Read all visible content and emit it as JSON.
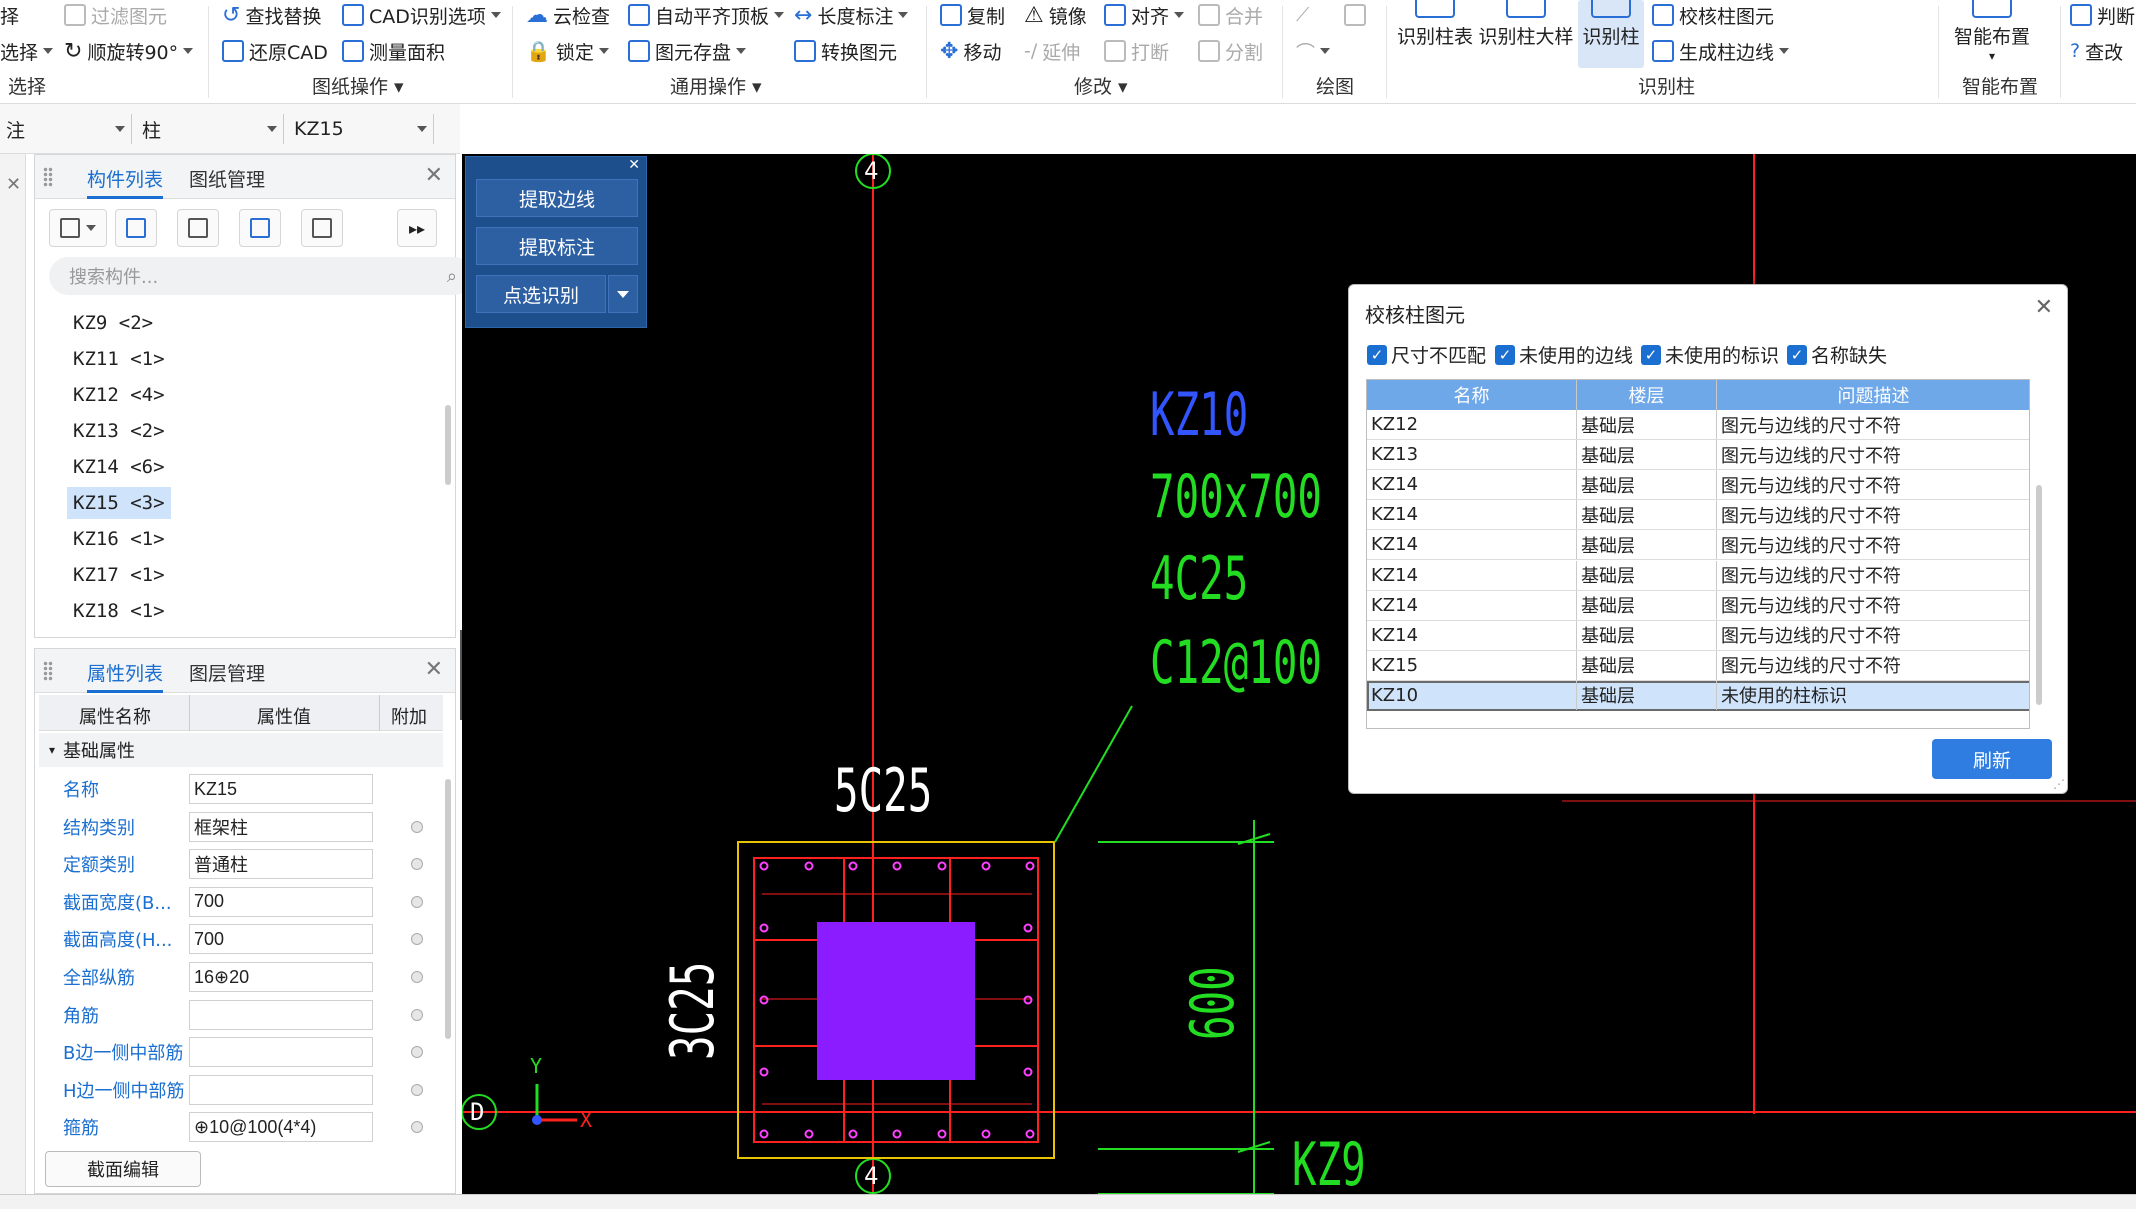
{
  "ribbon": {
    "select_group": {
      "item1": "择",
      "item2": "选择",
      "label": "选择",
      "filter": "过滤图元",
      "rotate": "顺旋转90°"
    },
    "drawing_ops": {
      "find_replace": "查找替换",
      "cad_options": "CAD识别选项",
      "restore_cad": "还原CAD",
      "measure_area": "测量面积",
      "label": "图纸操作"
    },
    "general_ops": {
      "cloud_check": "云检查",
      "auto_level": "自动平齐顶板",
      "length_dim": "长度标注",
      "lock": "锁定",
      "save_elem": "图元存盘",
      "convert_elem": "转换图元",
      "label": "通用操作"
    },
    "modify": {
      "copy": "复制",
      "mirror": "镜像",
      "align": "对齐",
      "merge": "合并",
      "move": "移动",
      "extend": "延伸",
      "break": "打断",
      "split": "分割",
      "label": "修改"
    },
    "draw": {
      "label": "绘图"
    },
    "recognize_column": {
      "recog_table": "识别柱表",
      "recog_detail": "识别柱大样",
      "recog_column": "识别柱",
      "check_elem": "校核柱图元",
      "gen_edge": "生成柱边线",
      "label": "识别柱"
    },
    "smart_layout": {
      "btn": "智能布置",
      "label": "智能布置"
    },
    "judge": {
      "item1": "判断",
      "item2": "查改"
    }
  },
  "selector_bar": {
    "floor": "注",
    "type": "柱",
    "component": "KZ15"
  },
  "component_panel": {
    "tab_active": "构件列表",
    "tab_other": "图纸管理",
    "search_placeholder": "搜索构件...",
    "items": [
      "KZ9 <2>",
      "KZ11 <1>",
      "KZ12 <4>",
      "KZ13 <2>",
      "KZ14 <6>",
      "KZ15 <3>",
      "KZ16 <1>",
      "KZ17 <1>",
      "KZ18 <1>"
    ],
    "selected_index": 5
  },
  "property_panel": {
    "tab_active": "属性列表",
    "tab_other": "图层管理",
    "col_name": "属性名称",
    "col_value": "属性值",
    "col_extra": "附加",
    "group": "基础属性",
    "rows": [
      {
        "name": "名称",
        "value": "KZ15"
      },
      {
        "name": "结构类别",
        "value": "框架柱"
      },
      {
        "name": "定额类别",
        "value": "普通柱"
      },
      {
        "name": "截面宽度(B...",
        "value": "700"
      },
      {
        "name": "截面高度(H...",
        "value": "700"
      },
      {
        "name": "全部纵筋",
        "value": "16⊕20"
      },
      {
        "name": "角筋",
        "value": ""
      },
      {
        "name": "B边一侧中部筋",
        "value": ""
      },
      {
        "name": "H边一侧中部筋",
        "value": ""
      },
      {
        "name": "箍筋",
        "value": "⊕10@100(4*4)"
      }
    ],
    "edit_button": "截面编辑"
  },
  "float_panel": {
    "btn1": "提取边线",
    "btn2": "提取标注",
    "btn3": "点选识别"
  },
  "cad": {
    "axis_top": "4",
    "axis_bottom": "4",
    "axis_left": "D",
    "label_name": "KZ10",
    "label_size": "700x700",
    "label_corner": "4C25",
    "label_stirrup": "C12@100",
    "top_bars": "5C25",
    "side_bars": "3C25",
    "dim": "600",
    "kz9": "KZ9",
    "ucs_y": "Y",
    "ucs_x": "X"
  },
  "dialog": {
    "title": "校核柱图元",
    "checks": [
      "尺寸不匹配",
      "未使用的边线",
      "未使用的标识",
      "名称缺失"
    ],
    "headers": [
      "名称",
      "楼层",
      "问题描述"
    ],
    "rows": [
      {
        "name": "KZ12",
        "floor": "基础层",
        "desc": "图元与边线的尺寸不符"
      },
      {
        "name": "KZ13",
        "floor": "基础层",
        "desc": "图元与边线的尺寸不符"
      },
      {
        "name": "KZ14",
        "floor": "基础层",
        "desc": "图元与边线的尺寸不符"
      },
      {
        "name": "KZ14",
        "floor": "基础层",
        "desc": "图元与边线的尺寸不符"
      },
      {
        "name": "KZ14",
        "floor": "基础层",
        "desc": "图元与边线的尺寸不符"
      },
      {
        "name": "KZ14",
        "floor": "基础层",
        "desc": "图元与边线的尺寸不符"
      },
      {
        "name": "KZ14",
        "floor": "基础层",
        "desc": "图元与边线的尺寸不符"
      },
      {
        "name": "KZ14",
        "floor": "基础层",
        "desc": "图元与边线的尺寸不符"
      },
      {
        "name": "KZ15",
        "floor": "基础层",
        "desc": "图元与边线的尺寸不符"
      },
      {
        "name": "KZ10",
        "floor": "基础层",
        "desc": "未使用的柱标识"
      }
    ],
    "selected_row": 9,
    "refresh": "刷新"
  },
  "colors": {
    "accent": "#1a6fd0",
    "cad_bg": "#000000",
    "cad_red": "#ff2020",
    "cad_green": "#22dd22",
    "cad_blue": "#3355ff",
    "cad_yellow": "#e8c400",
    "cad_purple": "#8a1cff",
    "cad_white": "#ffffff"
  }
}
